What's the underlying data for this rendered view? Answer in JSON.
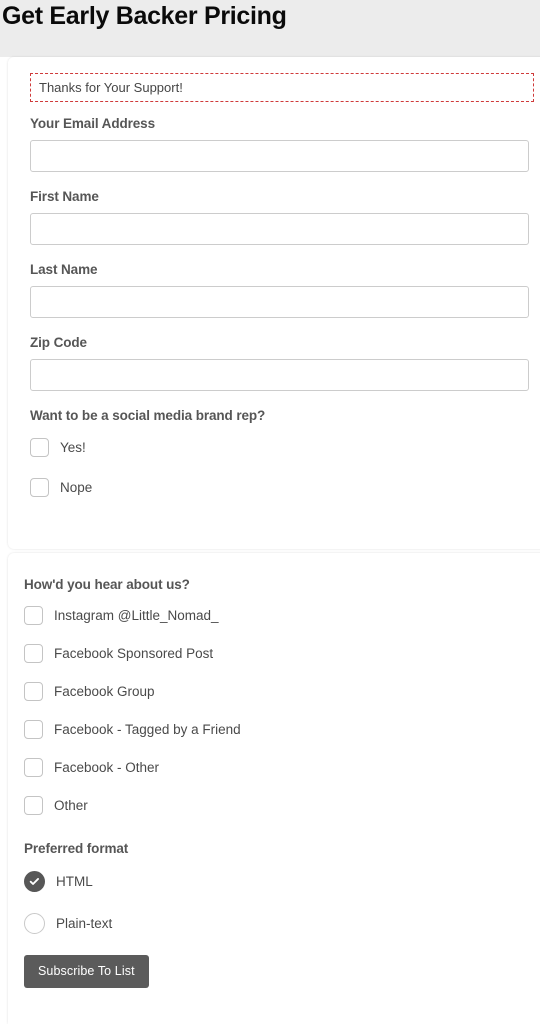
{
  "header": {
    "title": "Get Early Backer Pricing"
  },
  "notice": {
    "text": "Thanks for Your Support!",
    "border_color": "#cf3a3a"
  },
  "form": {
    "fields": [
      {
        "label": "Your Email Address",
        "value": "",
        "placeholder": ""
      },
      {
        "label": "First Name",
        "value": "",
        "placeholder": ""
      },
      {
        "label": "Last Name",
        "value": "",
        "placeholder": ""
      },
      {
        "label": "Zip Code",
        "value": "",
        "placeholder": ""
      }
    ],
    "brand_rep": {
      "heading": "Want to be a social media brand rep?",
      "options": [
        {
          "label": "Yes!",
          "checked": false
        },
        {
          "label": "Nope",
          "checked": false
        }
      ]
    },
    "referral": {
      "heading": "How'd you hear about us?",
      "options": [
        {
          "label": "Instagram @Little_Nomad_",
          "checked": false
        },
        {
          "label": "Facebook Sponsored Post",
          "checked": false
        },
        {
          "label": "Facebook Group",
          "checked": false
        },
        {
          "label": "Facebook - Tagged by a Friend",
          "checked": false
        },
        {
          "label": "Facebook - Other",
          "checked": false
        },
        {
          "label": "Other",
          "checked": false
        }
      ]
    },
    "preferred_format": {
      "heading": "Preferred format",
      "options": [
        {
          "label": "HTML",
          "checked": true
        },
        {
          "label": "Plain-text",
          "checked": false
        }
      ]
    },
    "submit_label": "Subscribe To List"
  },
  "colors": {
    "page_background": "#ececec",
    "card_background": "#ffffff",
    "label_text": "#565656",
    "body_text": "#4a4a4a",
    "button_background": "#5b5b5b",
    "accent_dashed": "#cf3a3a",
    "radio_selected": "#575757"
  }
}
